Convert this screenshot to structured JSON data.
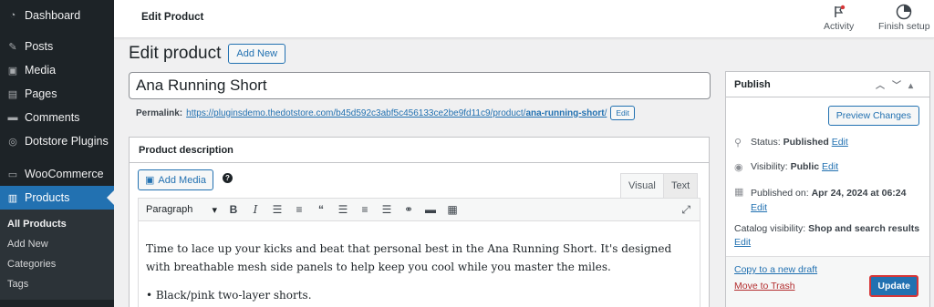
{
  "sidebar": {
    "items": [
      {
        "label": "Dashboard",
        "icon": "dashboard-icon"
      },
      {
        "label": "Posts",
        "icon": "pin-icon"
      },
      {
        "label": "Media",
        "icon": "media-icon"
      },
      {
        "label": "Pages",
        "icon": "pages-icon"
      },
      {
        "label": "Comments",
        "icon": "comment-icon"
      },
      {
        "label": "Dotstore Plugins",
        "icon": "plugin-icon"
      },
      {
        "label": "WooCommerce",
        "icon": "woo-icon"
      },
      {
        "label": "Products",
        "icon": "products-icon"
      }
    ],
    "submenu": [
      "All Products",
      "Add New",
      "Categories",
      "Tags"
    ]
  },
  "topbar": {
    "title": "Edit Product",
    "activity": "Activity",
    "finish_setup": "Finish setup"
  },
  "main": {
    "heading": "Edit product",
    "add_new": "Add New",
    "product_title": "Ana Running Short",
    "permalink_label": "Permalink:",
    "permalink_base": "https://pluginsdemo.thedotstore.com/b45d592c3abf5c456133ce2be9fd11c9/product/",
    "permalink_slug": "ana-running-short",
    "permalink_end": "/",
    "permalink_edit": "Edit"
  },
  "description": {
    "title": "Product description",
    "add_media": "Add Media",
    "help": "?",
    "tab_visual": "Visual",
    "tab_text": "Text",
    "format": "Paragraph",
    "paragraph1": "Time to lace up your kicks and beat that personal best in the Ana Running Short. It's designed with breathable mesh side panels to help keep you cool while you master the miles.",
    "bullet1": "• Black/pink two-layer shorts."
  },
  "publish": {
    "title": "Publish",
    "preview": "Preview Changes",
    "status_label": "Status:",
    "status_value": "Published",
    "visibility_label": "Visibility:",
    "visibility_value": "Public",
    "published_label": "Published on:",
    "published_value": "Apr 24, 2024 at 06:24",
    "catalog_label": "Catalog visibility:",
    "catalog_value": "Shop and search results",
    "edit": "Edit",
    "copy_draft": "Copy to a new draft",
    "trash": "Move to Trash",
    "update": "Update"
  },
  "colors": {
    "admin_dark": "#1d2327",
    "primary": "#2271b1",
    "danger": "#b32d2e"
  }
}
